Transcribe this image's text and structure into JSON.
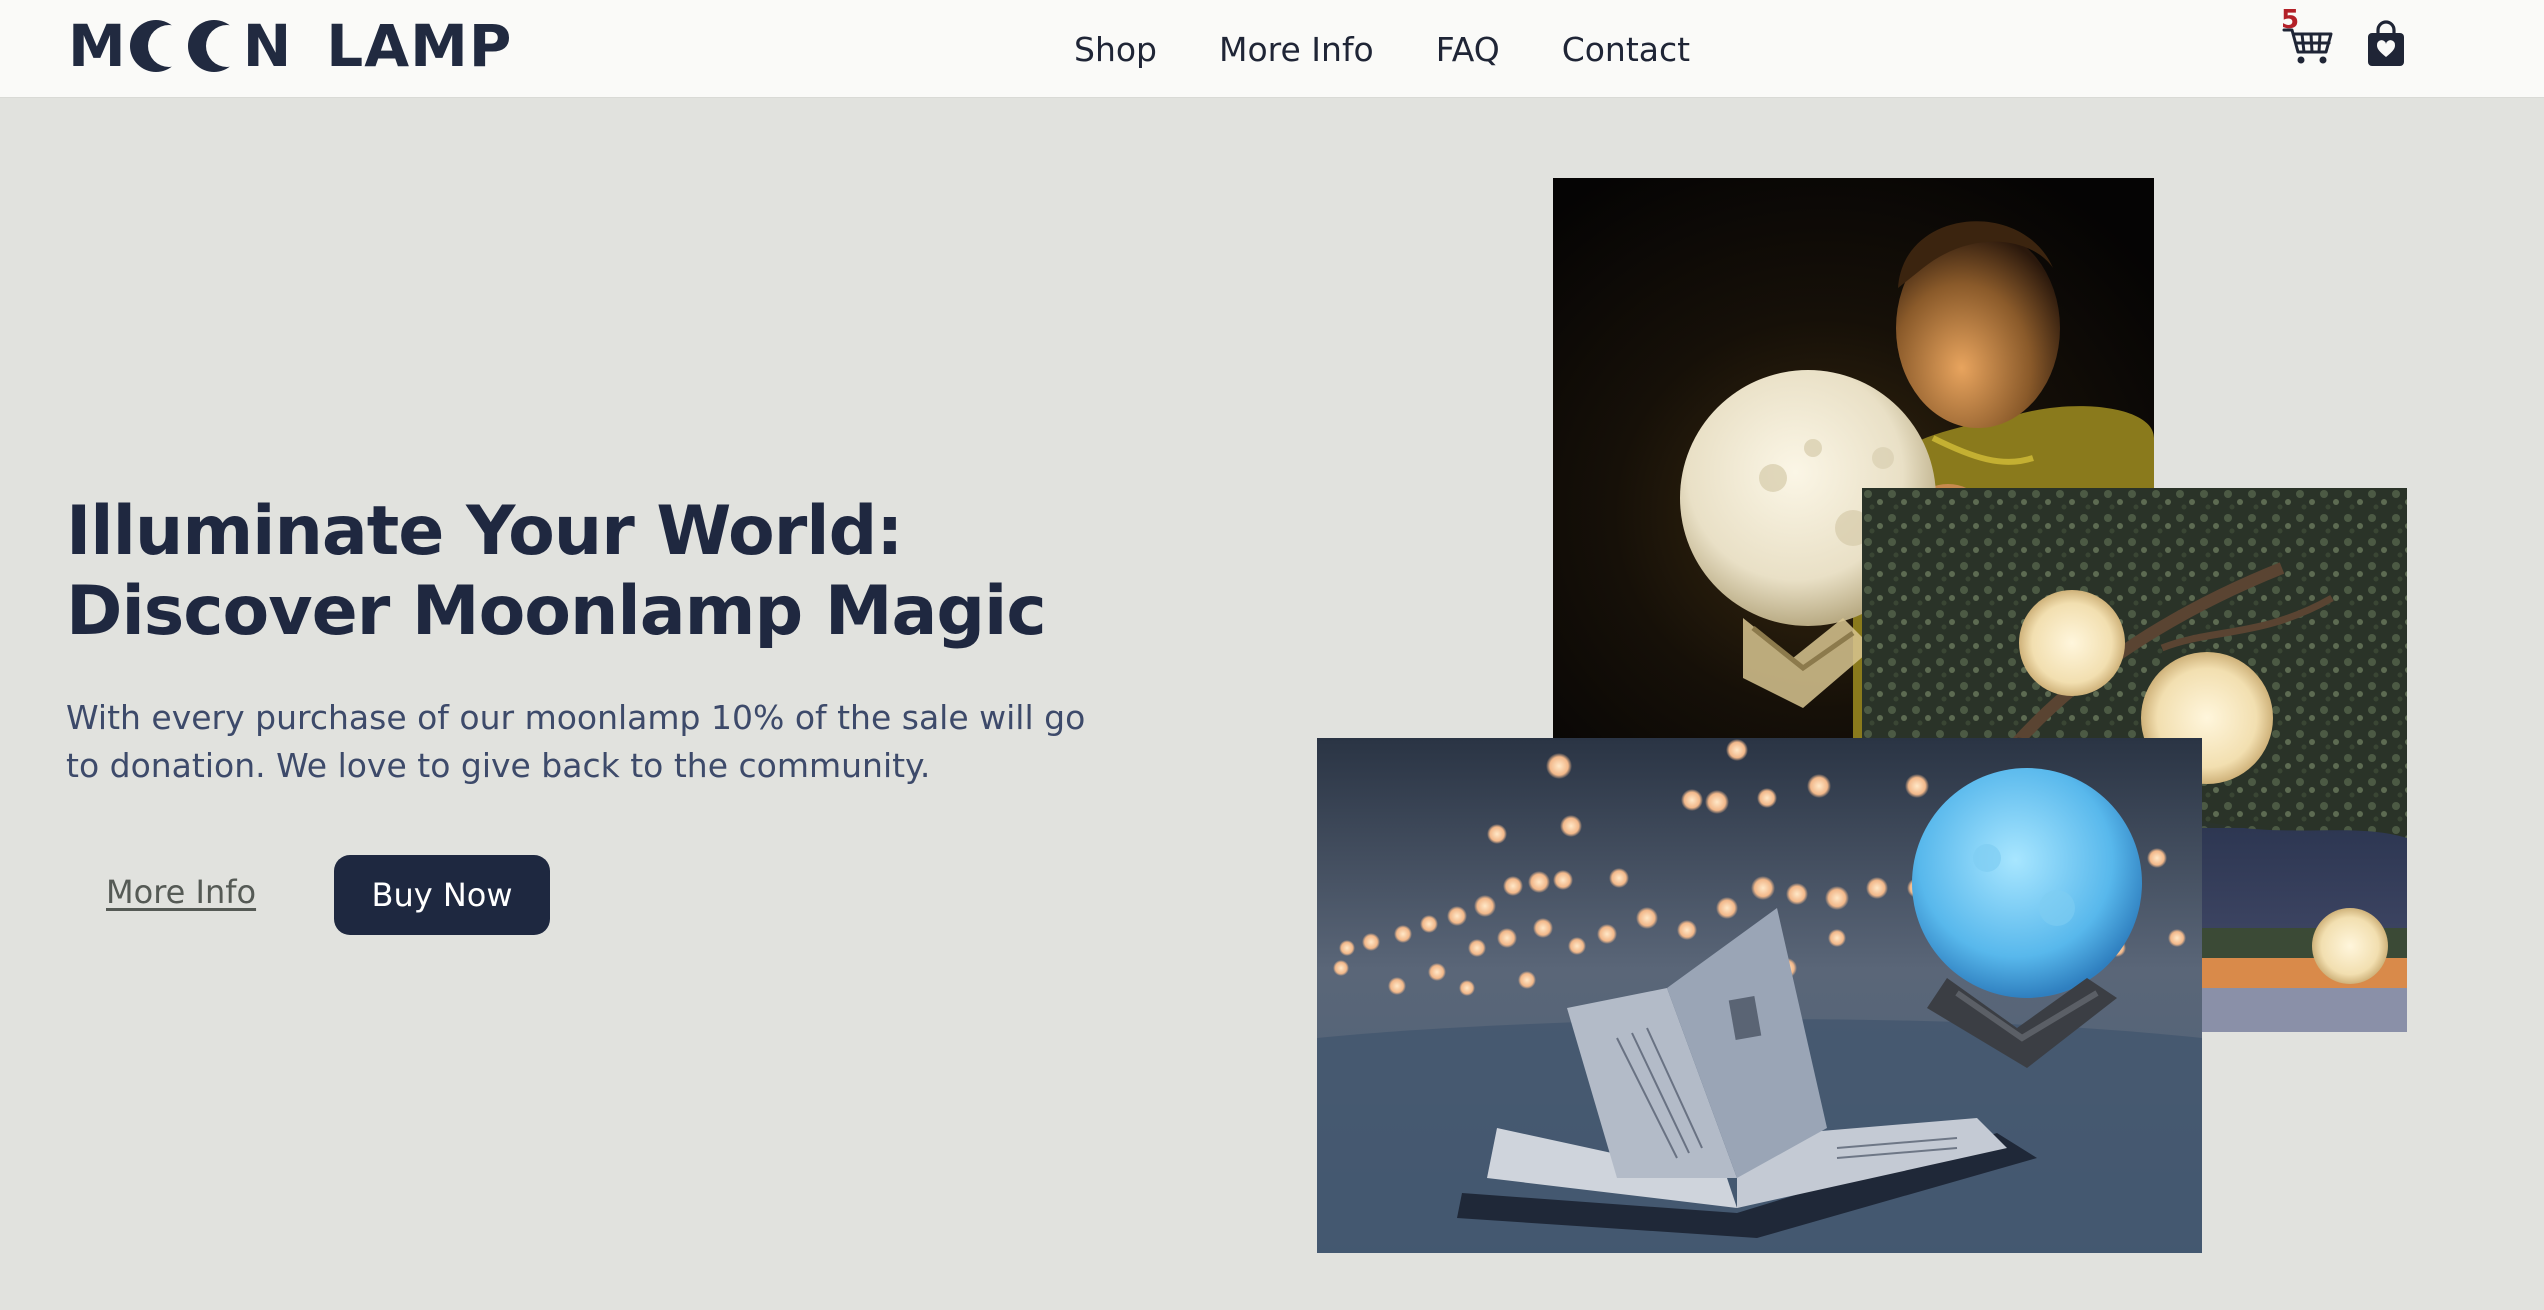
{
  "header": {
    "logo": {
      "prefix": "M",
      "suffix": "N",
      "second_word": "LAMP",
      "full_text": "MOON LAMP"
    },
    "nav": [
      {
        "label": "Shop"
      },
      {
        "label": "More Info"
      },
      {
        "label": "FAQ"
      },
      {
        "label": "Contact"
      }
    ],
    "cart": {
      "count": "5",
      "icon": "shopping-cart-icon"
    },
    "bag": {
      "icon": "shopping-bag-heart-icon"
    }
  },
  "hero": {
    "headline_line1": "Illuminate Your World:",
    "headline_line2": "Discover Moonlamp Magic",
    "description": "With every purchase of our moonlamp 10% of the sale will go to donation. We love to give back to the community.",
    "more_info_label": "More Info",
    "buy_label": "Buy Now"
  },
  "images": [
    {
      "name": "child-with-moon-lamp-photo"
    },
    {
      "name": "moon-lamps-in-tree-photo"
    },
    {
      "name": "blue-moon-lamp-with-book-photo"
    }
  ],
  "colors": {
    "background": "#e1e2de",
    "header_background": "#fafaf8",
    "primary_navy": "#1e2840",
    "body_text": "#3d4a6a",
    "cart_badge": "#b32028"
  }
}
